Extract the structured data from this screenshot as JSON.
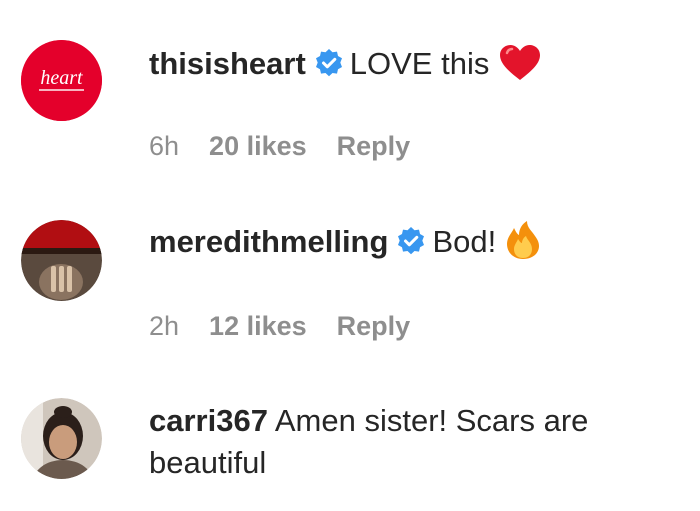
{
  "comments": [
    {
      "username": "thisisheart",
      "verified": true,
      "text": "LOVE this",
      "emoji": "heart-emoji",
      "avatar_text": "heart",
      "avatar_color": "#e4002b",
      "time": "6h",
      "likes": "20 likes",
      "reply": "Reply"
    },
    {
      "username": "meredithmelling",
      "verified": true,
      "text": "Bod!",
      "emoji": "fire-emoji",
      "time": "2h",
      "likes": "12 likes",
      "reply": "Reply"
    },
    {
      "username": "carri367",
      "verified": false,
      "text": "Amen sister! Scars are beautiful"
    }
  ],
  "colors": {
    "text": "#262626",
    "meta": "#8e8e8e",
    "verified": "#3897f0",
    "heart_brand": "#e4002b"
  }
}
